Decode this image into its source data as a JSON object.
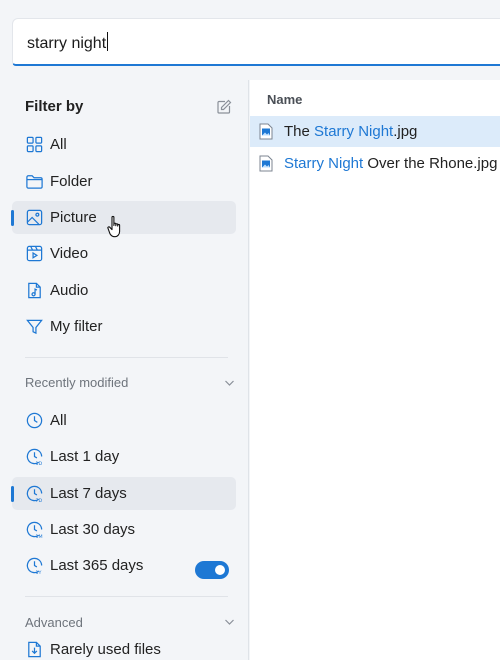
{
  "search": {
    "query": "starry night"
  },
  "sidebar": {
    "filter_header": "Filter by",
    "filters": [
      {
        "label": "All",
        "icon": "grid-icon"
      },
      {
        "label": "Folder",
        "icon": "folder-icon"
      },
      {
        "label": "Picture",
        "icon": "picture-icon",
        "selected": true
      },
      {
        "label": "Video",
        "icon": "video-icon"
      },
      {
        "label": "Audio",
        "icon": "audio-file-icon"
      },
      {
        "label": "My filter",
        "icon": "funnel-icon"
      }
    ],
    "recent_title": "Recently modified",
    "recent": [
      {
        "label": "All",
        "icon": "clock-icon"
      },
      {
        "label": "Last 1 day",
        "icon": "clock-1d-icon"
      },
      {
        "label": "Last 7 days",
        "icon": "clock-7d-icon",
        "selected": true
      },
      {
        "label": "Last 30 days",
        "icon": "clock-1m-icon"
      },
      {
        "label": "Last 365 days",
        "icon": "clock-1y-icon"
      }
    ],
    "advanced_title": "Advanced",
    "advanced": [
      {
        "label": "Rarely used files",
        "icon": "download-file-icon",
        "toggle_on": true
      }
    ]
  },
  "results": {
    "column_header": "Name",
    "files": [
      {
        "before": "The ",
        "match": "Starry Night",
        "after": ".jpg",
        "selected": true
      },
      {
        "before": "",
        "match": "Starry Night",
        "after": " Over the Rhone.jpg",
        "selected": false
      }
    ]
  },
  "colors": {
    "accent": "#1e78d4",
    "selected_row": "#dcebfa",
    "sidebar_bg": "#f3f5f8"
  }
}
